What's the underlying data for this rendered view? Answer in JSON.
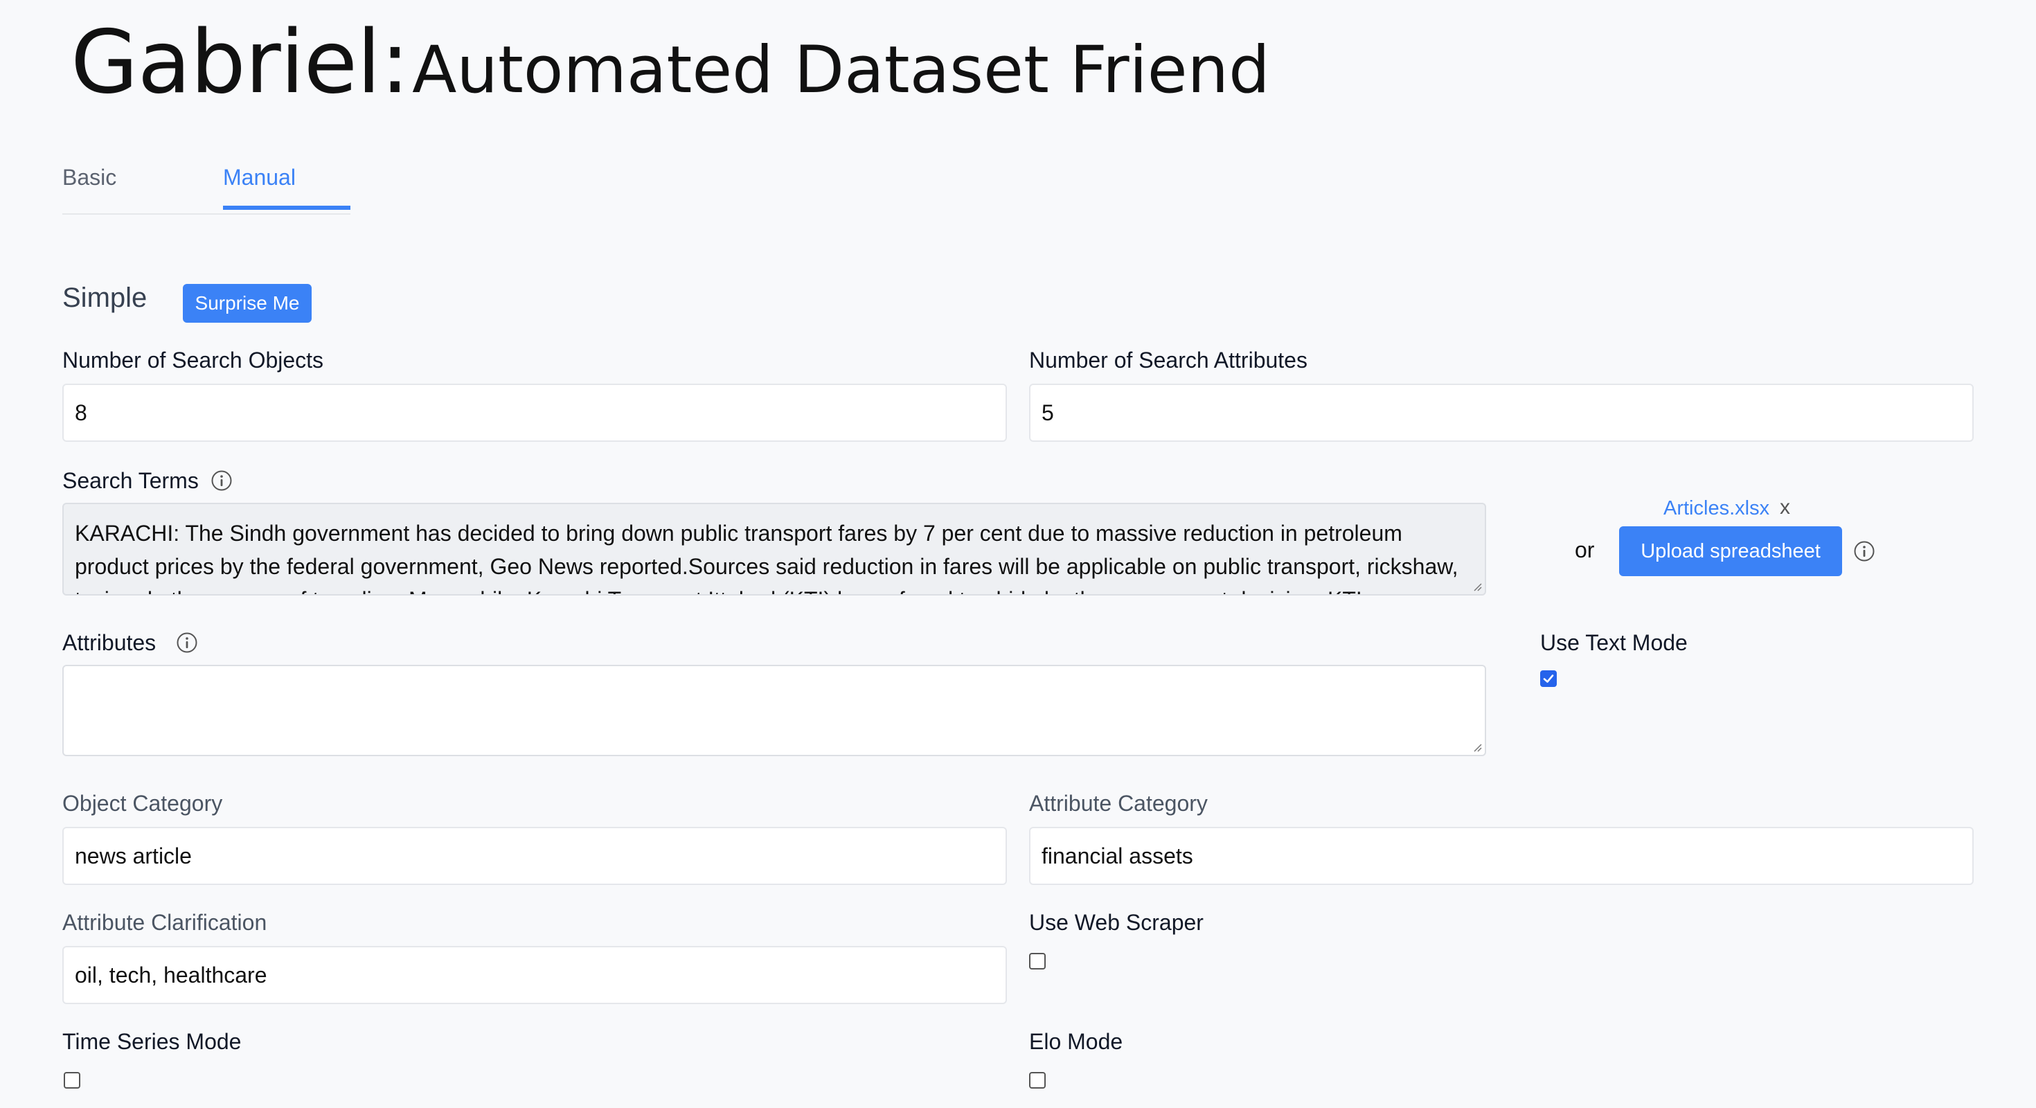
{
  "header": {
    "title_main": "Gabriel:",
    "title_sub": "Automated Dataset Friend"
  },
  "tabs": [
    {
      "label": "Basic"
    },
    {
      "label": "Manual",
      "active": true
    }
  ],
  "section": {
    "title": "Simple",
    "surprise_label": "Surprise Me"
  },
  "fields": {
    "num_objects": {
      "label": "Number of Search Objects",
      "value": "8"
    },
    "num_attributes": {
      "label": "Number of Search Attributes",
      "value": "5"
    },
    "search_terms": {
      "label": "Search Terms",
      "value": "KARACHI: The Sindh government has decided to bring down public transport fares by 7 per cent due to massive reduction in petroleum product prices by the federal government, Geo News reported.Sources said reduction in fares will be applicable on public transport, rickshaw, taxi and other means of traveling. Meanwhile, Karachi Transport Ittehad (KTI) has refused to abide by the government decision. KTI"
    },
    "attributes": {
      "label": "Attributes",
      "value": ""
    },
    "object_category": {
      "label": "Object Category",
      "value": "news article"
    },
    "attribute_category": {
      "label": "Attribute Category",
      "value": "financial assets"
    },
    "attribute_clarification": {
      "label": "Attribute Clarification",
      "value": "oil, tech, healthcare"
    },
    "use_text_mode": {
      "label": "Use Text Mode",
      "checked": true
    },
    "use_web_scraper": {
      "label": "Use Web Scraper",
      "checked": false
    },
    "time_series_mode": {
      "label": "Time Series Mode",
      "checked": false
    },
    "elo_mode": {
      "label": "Elo Mode",
      "checked": false
    }
  },
  "upload": {
    "or_text": "or",
    "button_label": "Upload spreadsheet",
    "file_name": "Articles.xlsx",
    "remove_symbol": "x"
  },
  "colors": {
    "accent": "#3b82f6",
    "background": "#f8f9fb",
    "checkbox_checked": "#2563eb"
  },
  "icons": {
    "info": "info-circle-icon",
    "check": "checkmark-icon",
    "resize": "resize-grip-icon",
    "remove": "close-icon"
  }
}
